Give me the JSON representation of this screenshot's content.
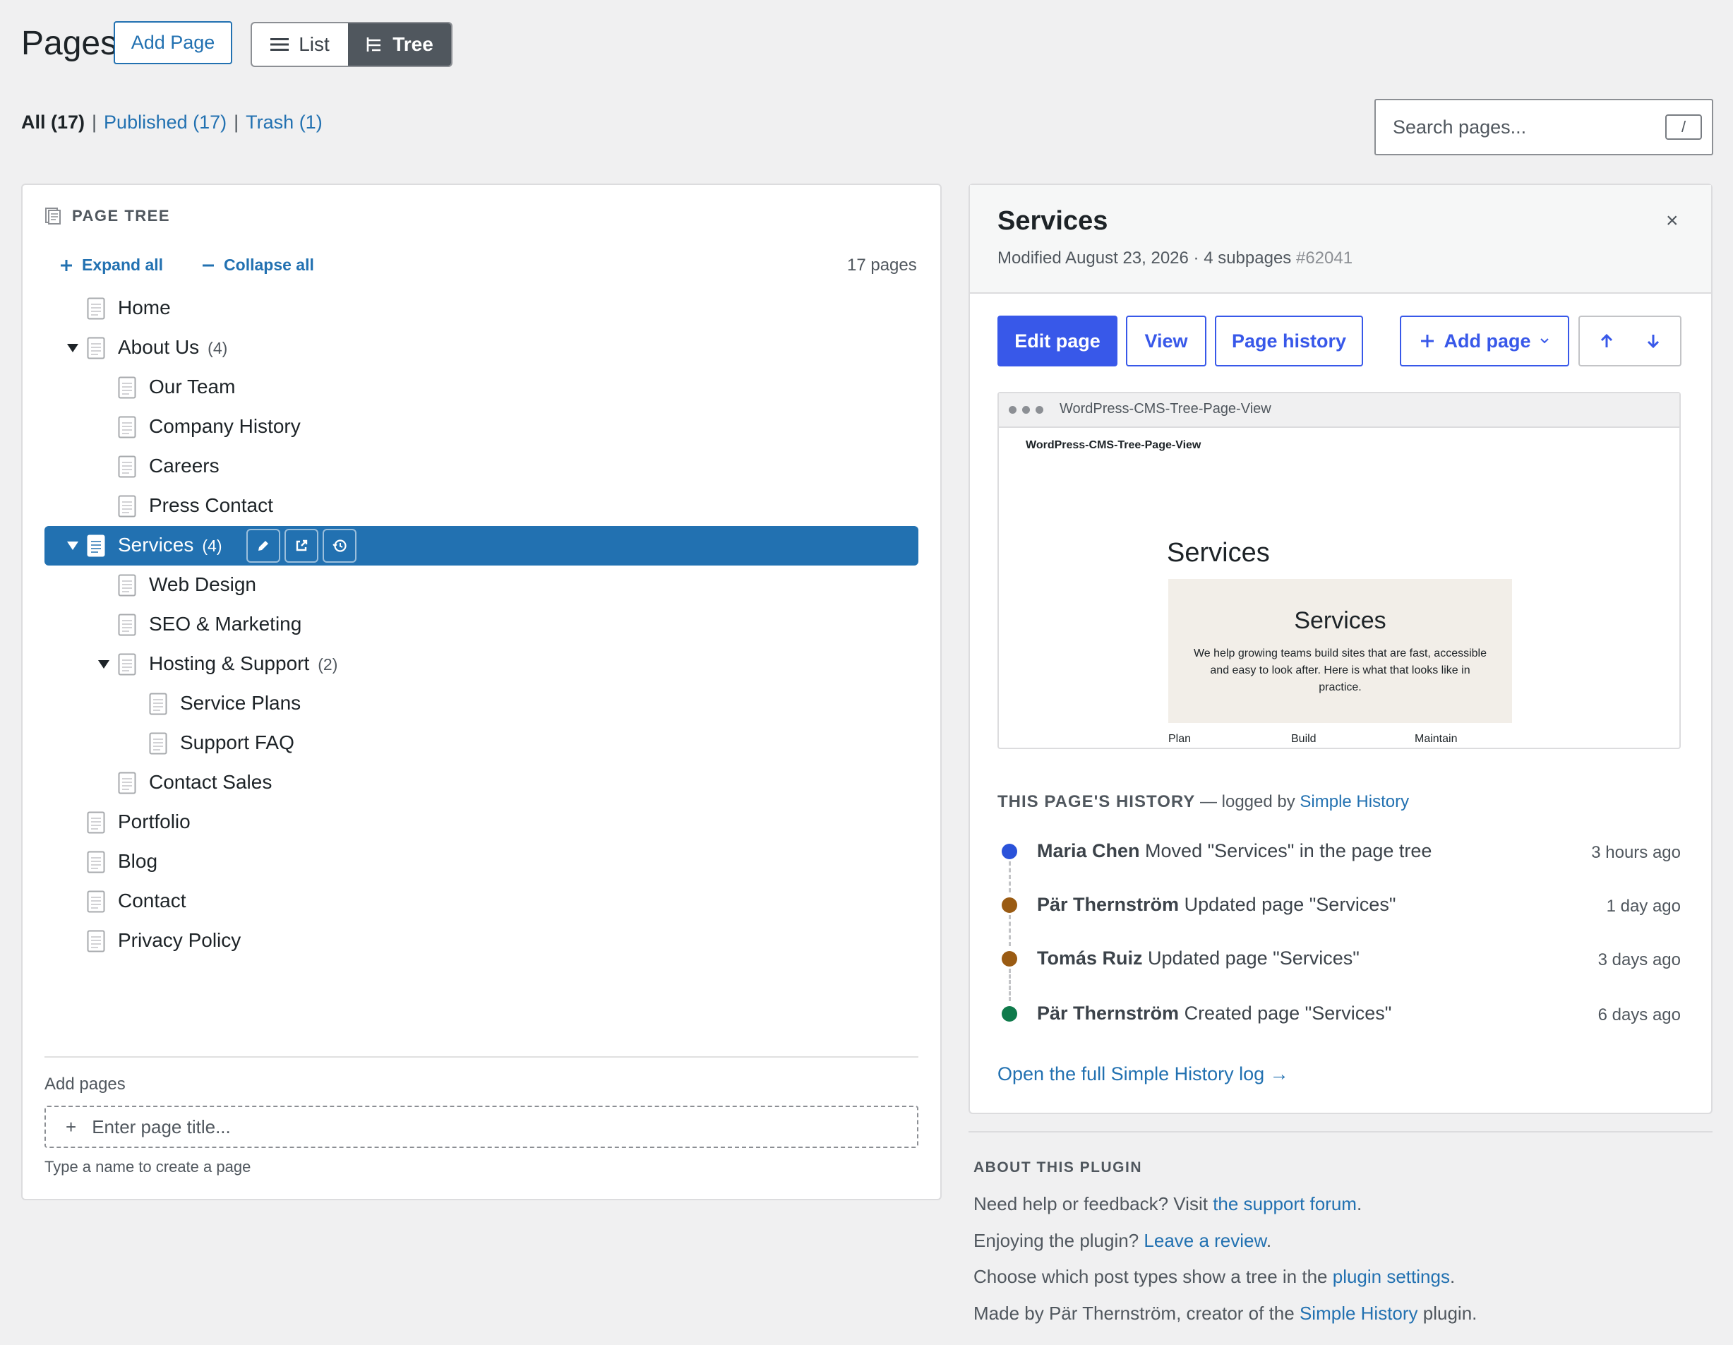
{
  "header": {
    "title": "Pages",
    "add_page": "Add Page",
    "view_list": "List",
    "view_tree": "Tree"
  },
  "filters": {
    "all": "All (17)",
    "sep": "|",
    "published": "Published (17)",
    "trash": "Trash (1)"
  },
  "search": {
    "placeholder": "Search pages...",
    "shortcut": "/"
  },
  "tree": {
    "heading": "PAGE TREE",
    "expand_all": "Expand all",
    "collapse_all": "Collapse all",
    "count": "17 pages",
    "items": [
      {
        "label": "Home",
        "count": ""
      },
      {
        "label": "About Us",
        "count": "(4)"
      },
      {
        "label": "Our Team",
        "count": ""
      },
      {
        "label": "Company History",
        "count": ""
      },
      {
        "label": "Careers",
        "count": ""
      },
      {
        "label": "Press Contact",
        "count": ""
      },
      {
        "label": "Services",
        "count": "(4)"
      },
      {
        "label": "Web Design",
        "count": ""
      },
      {
        "label": "SEO & Marketing",
        "count": ""
      },
      {
        "label": "Hosting & Support",
        "count": "(2)"
      },
      {
        "label": "Service Plans",
        "count": ""
      },
      {
        "label": "Support FAQ",
        "count": ""
      },
      {
        "label": "Contact Sales",
        "count": ""
      },
      {
        "label": "Portfolio",
        "count": ""
      },
      {
        "label": "Blog",
        "count": ""
      },
      {
        "label": "Contact",
        "count": ""
      },
      {
        "label": "Privacy Policy",
        "count": ""
      }
    ],
    "add_label": "Add pages",
    "add_placeholder": "Enter page title...",
    "add_hint": "Type a name to create a page"
  },
  "detail": {
    "title": "Services",
    "meta": "Modified August 23, 2026 · 4 subpages",
    "id": "#62041",
    "close": "×",
    "buttons": {
      "edit": "Edit page",
      "view": "View",
      "history": "Page history",
      "add": "Add page"
    },
    "preview": {
      "url": "WordPress-CMS-Tree-Page-View",
      "site_title": "WordPress-CMS-Tree-Page-View",
      "heading": "Services",
      "hero_title": "Services",
      "hero_text": "We help growing teams build sites that are fast, accessible and easy to look after. Here is what that looks like in practice.",
      "columns": [
        "Plan",
        "Build",
        "Maintain"
      ]
    },
    "history": {
      "heading": "THIS PAGE'S HISTORY",
      "logged_by": " — logged by ",
      "logger": "Simple History",
      "items": [
        {
          "user": "Maria Chen",
          "action": " Moved \"Services\" in the page tree",
          "time": "3 hours ago",
          "color": "#2a52d9"
        },
        {
          "user": "Pär Thernström",
          "action": " Updated page \"Services\"",
          "time": "1 day ago",
          "color": "#9a5b13"
        },
        {
          "user": "Tomás Ruiz",
          "action": " Updated page \"Services\"",
          "time": "3 days ago",
          "color": "#9a5b13"
        },
        {
          "user": "Pär Thernström",
          "action": " Created page \"Services\"",
          "time": "6 days ago",
          "color": "#0f7a4b"
        }
      ],
      "open_log": "Open the full Simple History log →"
    }
  },
  "about": {
    "heading": "ABOUT THIS PLUGIN",
    "line1_text": "Need help or feedback? Visit ",
    "line1_link": "the support forum",
    "line2_text": "Enjoying the plugin? ",
    "line2_link": "Leave a review",
    "line3_text": "Choose which post types show a tree in the ",
    "line3_link": "plugin settings",
    "line4_text": "Made by Pär Thernström, creator of the ",
    "line4_link": "Simple History",
    "line4_tail": " plugin.",
    "period": "."
  },
  "colors": {
    "accent": "#2271b1",
    "primary_button": "#3858e9",
    "selected_row": "#2271b1"
  }
}
